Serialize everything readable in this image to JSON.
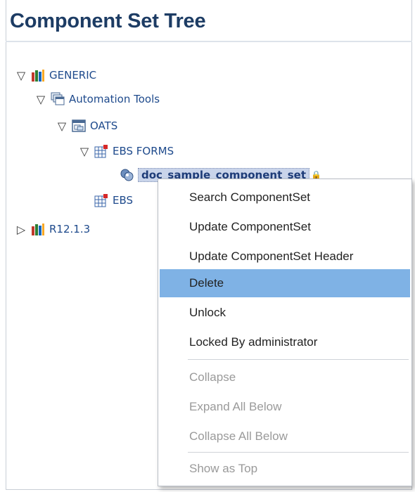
{
  "title": "Component Set Tree",
  "tree": {
    "generic": "GENERIC",
    "automation_tools": "Automation Tools",
    "oats": "OATS",
    "ebs_forms": "EBS FORMS",
    "selected_item": "doc_sample_component_set",
    "ebs_other": "EBS",
    "r12": "R12.1.3"
  },
  "context_menu": {
    "items": [
      {
        "label": "Search ComponentSet",
        "enabled": true
      },
      {
        "label": "Update ComponentSet",
        "enabled": true
      },
      {
        "label": "Update ComponentSet Header",
        "enabled": true
      },
      {
        "label": "Delete",
        "enabled": true,
        "highlighted": true
      },
      {
        "label": "Unlock",
        "enabled": true
      },
      {
        "label": "Locked By administrator",
        "enabled": true
      },
      {
        "label": "Collapse",
        "enabled": false
      },
      {
        "label": "Expand All Below",
        "enabled": false
      },
      {
        "label": "Collapse All Below",
        "enabled": false
      },
      {
        "label": "Show as Top",
        "enabled": false
      }
    ]
  },
  "colors": {
    "title": "#1d3c64",
    "link": "#1e4a8c",
    "menu_highlight": "#7fb2e5"
  }
}
